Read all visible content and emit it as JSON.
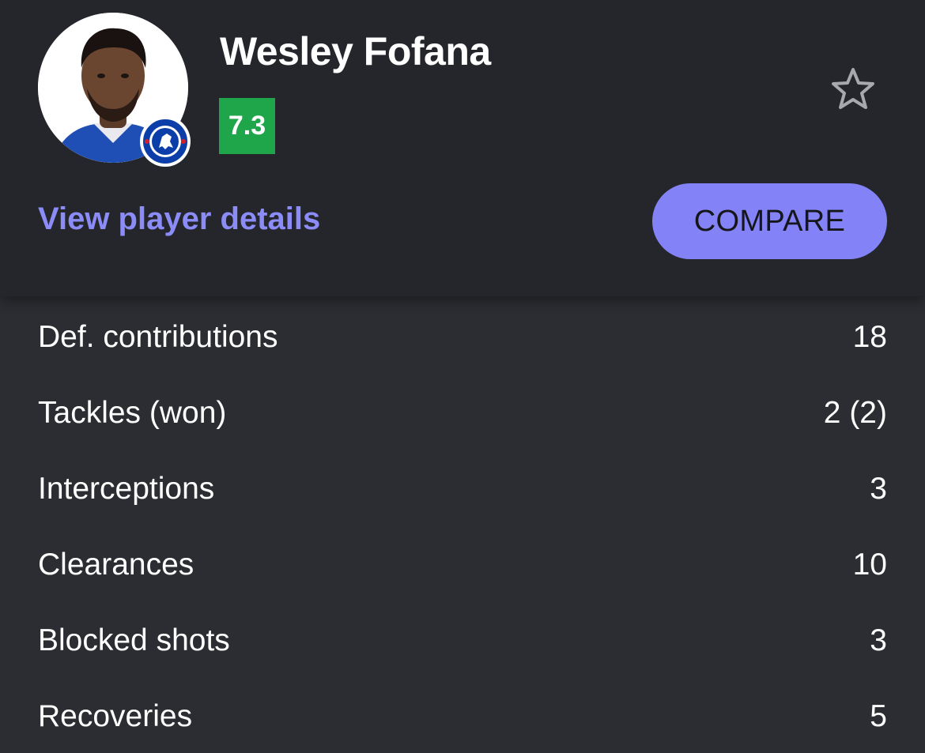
{
  "player": {
    "name": "Wesley Fofana",
    "rating": "7.3",
    "rating_color": "#1fa64a",
    "avatar_icon": "player-photo",
    "club_icon": "chelsea-crest",
    "favorite_icon": "star-outline-icon"
  },
  "actions": {
    "details_link": "View player details",
    "compare_button": "COMPARE"
  },
  "colors": {
    "accent": "#8383f7",
    "link": "#8b8cf7",
    "background": "#2b2d32",
    "header_background": "#24262b"
  },
  "stats": [
    {
      "label": "Def. contributions",
      "value": "18"
    },
    {
      "label": "Tackles (won)",
      "value": "2 (2)"
    },
    {
      "label": "Interceptions",
      "value": "3"
    },
    {
      "label": "Clearances",
      "value": "10"
    },
    {
      "label": "Blocked shots",
      "value": "3"
    },
    {
      "label": "Recoveries",
      "value": "5"
    }
  ]
}
